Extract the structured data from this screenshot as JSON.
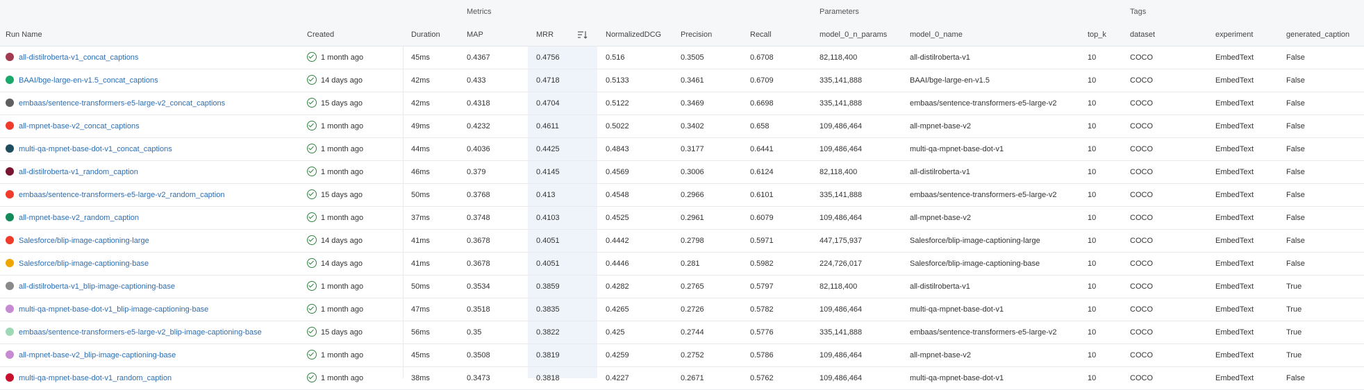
{
  "groups": {
    "metrics": "Metrics",
    "parameters": "Parameters",
    "tags": "Tags"
  },
  "columns": {
    "run_name": "Run Name",
    "created": "Created",
    "duration": "Duration",
    "map": "MAP",
    "mrr": "MRR",
    "ndcg": "NormalizedDCG",
    "precision": "Precision",
    "recall": "Recall",
    "n_params": "model_0_n_params",
    "model_name": "model_0_name",
    "top_k": "top_k",
    "dataset": "dataset",
    "experiment": "experiment",
    "generated_caption": "generated_caption"
  },
  "rows": [
    {
      "color": "#a23b52",
      "name": "all-distilroberta-v1_concat_captions",
      "created": "1 month ago",
      "duration": "45ms",
      "map": "0.4367",
      "mrr": "0.4756",
      "ndcg": "0.516",
      "precision": "0.3505",
      "recall": "0.6708",
      "n_params": "82,118,400",
      "model_name": "all-distilroberta-v1",
      "top_k": "10",
      "dataset": "COCO",
      "experiment": "EmbedText",
      "generated_caption": "False"
    },
    {
      "color": "#1aa86b",
      "name": "BAAI/bge-large-en-v1.5_concat_captions",
      "created": "14 days ago",
      "duration": "42ms",
      "map": "0.433",
      "mrr": "0.4718",
      "ndcg": "0.5133",
      "precision": "0.3461",
      "recall": "0.6709",
      "n_params": "335,141,888",
      "model_name": "BAAI/bge-large-en-v1.5",
      "top_k": "10",
      "dataset": "COCO",
      "experiment": "EmbedText",
      "generated_caption": "False"
    },
    {
      "color": "#5f5f5f",
      "name": "embaas/sentence-transformers-e5-large-v2_concat_captions",
      "created": "15 days ago",
      "duration": "42ms",
      "map": "0.4318",
      "mrr": "0.4704",
      "ndcg": "0.5122",
      "precision": "0.3469",
      "recall": "0.6698",
      "n_params": "335,141,888",
      "model_name": "embaas/sentence-transformers-e5-large-v2",
      "top_k": "10",
      "dataset": "COCO",
      "experiment": "EmbedText",
      "generated_caption": "False"
    },
    {
      "color": "#ef3b2c",
      "name": "all-mpnet-base-v2_concat_captions",
      "created": "1 month ago",
      "duration": "49ms",
      "map": "0.4232",
      "mrr": "0.4611",
      "ndcg": "0.5022",
      "precision": "0.3402",
      "recall": "0.658",
      "n_params": "109,486,464",
      "model_name": "all-mpnet-base-v2",
      "top_k": "10",
      "dataset": "COCO",
      "experiment": "EmbedText",
      "generated_caption": "False"
    },
    {
      "color": "#1f4e5f",
      "name": "multi-qa-mpnet-base-dot-v1_concat_captions",
      "created": "1 month ago",
      "duration": "44ms",
      "map": "0.4036",
      "mrr": "0.4425",
      "ndcg": "0.4843",
      "precision": "0.3177",
      "recall": "0.6441",
      "n_params": "109,486,464",
      "model_name": "multi-qa-mpnet-base-dot-v1",
      "top_k": "10",
      "dataset": "COCO",
      "experiment": "EmbedText",
      "generated_caption": "False"
    },
    {
      "color": "#7a1531",
      "name": "all-distilroberta-v1_random_caption",
      "created": "1 month ago",
      "duration": "46ms",
      "map": "0.379",
      "mrr": "0.4145",
      "ndcg": "0.4569",
      "precision": "0.3006",
      "recall": "0.6124",
      "n_params": "82,118,400",
      "model_name": "all-distilroberta-v1",
      "top_k": "10",
      "dataset": "COCO",
      "experiment": "EmbedText",
      "generated_caption": "False"
    },
    {
      "color": "#ef3b2c",
      "name": "embaas/sentence-transformers-e5-large-v2_random_caption",
      "created": "15 days ago",
      "duration": "50ms",
      "map": "0.3768",
      "mrr": "0.413",
      "ndcg": "0.4548",
      "precision": "0.2966",
      "recall": "0.6101",
      "n_params": "335,141,888",
      "model_name": "embaas/sentence-transformers-e5-large-v2",
      "top_k": "10",
      "dataset": "COCO",
      "experiment": "EmbedText",
      "generated_caption": "False"
    },
    {
      "color": "#138a5a",
      "name": "all-mpnet-base-v2_random_caption",
      "created": "1 month ago",
      "duration": "37ms",
      "map": "0.3748",
      "mrr": "0.4103",
      "ndcg": "0.4525",
      "precision": "0.2961",
      "recall": "0.6079",
      "n_params": "109,486,464",
      "model_name": "all-mpnet-base-v2",
      "top_k": "10",
      "dataset": "COCO",
      "experiment": "EmbedText",
      "generated_caption": "False"
    },
    {
      "color": "#ef3b2c",
      "name": "Salesforce/blip-image-captioning-large",
      "created": "14 days ago",
      "duration": "41ms",
      "map": "0.3678",
      "mrr": "0.4051",
      "ndcg": "0.4442",
      "precision": "0.2798",
      "recall": "0.5971",
      "n_params": "447,175,937",
      "model_name": "Salesforce/blip-image-captioning-large",
      "top_k": "10",
      "dataset": "COCO",
      "experiment": "EmbedText",
      "generated_caption": "False"
    },
    {
      "color": "#f0a500",
      "name": "Salesforce/blip-image-captioning-base",
      "created": "14 days ago",
      "duration": "41ms",
      "map": "0.3678",
      "mrr": "0.4051",
      "ndcg": "0.4446",
      "precision": "0.281",
      "recall": "0.5982",
      "n_params": "224,726,017",
      "model_name": "Salesforce/blip-image-captioning-base",
      "top_k": "10",
      "dataset": "COCO",
      "experiment": "EmbedText",
      "generated_caption": "False"
    },
    {
      "color": "#8a8a8a",
      "name": "all-distilroberta-v1_blip-image-captioning-base",
      "created": "1 month ago",
      "duration": "50ms",
      "map": "0.3534",
      "mrr": "0.3859",
      "ndcg": "0.4282",
      "precision": "0.2765",
      "recall": "0.5797",
      "n_params": "82,118,400",
      "model_name": "all-distilroberta-v1",
      "top_k": "10",
      "dataset": "COCO",
      "experiment": "EmbedText",
      "generated_caption": "True"
    },
    {
      "color": "#c68ad3",
      "name": "multi-qa-mpnet-base-dot-v1_blip-image-captioning-base",
      "created": "1 month ago",
      "duration": "47ms",
      "map": "0.3518",
      "mrr": "0.3835",
      "ndcg": "0.4265",
      "precision": "0.2726",
      "recall": "0.5782",
      "n_params": "109,486,464",
      "model_name": "multi-qa-mpnet-base-dot-v1",
      "top_k": "10",
      "dataset": "COCO",
      "experiment": "EmbedText",
      "generated_caption": "True"
    },
    {
      "color": "#9fd8b5",
      "name": "embaas/sentence-transformers-e5-large-v2_blip-image-captioning-base",
      "created": "15 days ago",
      "duration": "56ms",
      "map": "0.35",
      "mrr": "0.3822",
      "ndcg": "0.425",
      "precision": "0.2744",
      "recall": "0.5776",
      "n_params": "335,141,888",
      "model_name": "embaas/sentence-transformers-e5-large-v2",
      "top_k": "10",
      "dataset": "COCO",
      "experiment": "EmbedText",
      "generated_caption": "True"
    },
    {
      "color": "#c68ad3",
      "name": "all-mpnet-base-v2_blip-image-captioning-base",
      "created": "1 month ago",
      "duration": "45ms",
      "map": "0.3508",
      "mrr": "0.3819",
      "ndcg": "0.4259",
      "precision": "0.2752",
      "recall": "0.5786",
      "n_params": "109,486,464",
      "model_name": "all-mpnet-base-v2",
      "top_k": "10",
      "dataset": "COCO",
      "experiment": "EmbedText",
      "generated_caption": "True"
    },
    {
      "color": "#c8102e",
      "name": "multi-qa-mpnet-base-dot-v1_random_caption",
      "created": "1 month ago",
      "duration": "38ms",
      "map": "0.3473",
      "mrr": "0.3818",
      "ndcg": "0.4227",
      "precision": "0.2671",
      "recall": "0.5762",
      "n_params": "109,486,464",
      "model_name": "multi-qa-mpnet-base-dot-v1",
      "top_k": "10",
      "dataset": "COCO",
      "experiment": "EmbedText",
      "generated_caption": "False"
    }
  ]
}
